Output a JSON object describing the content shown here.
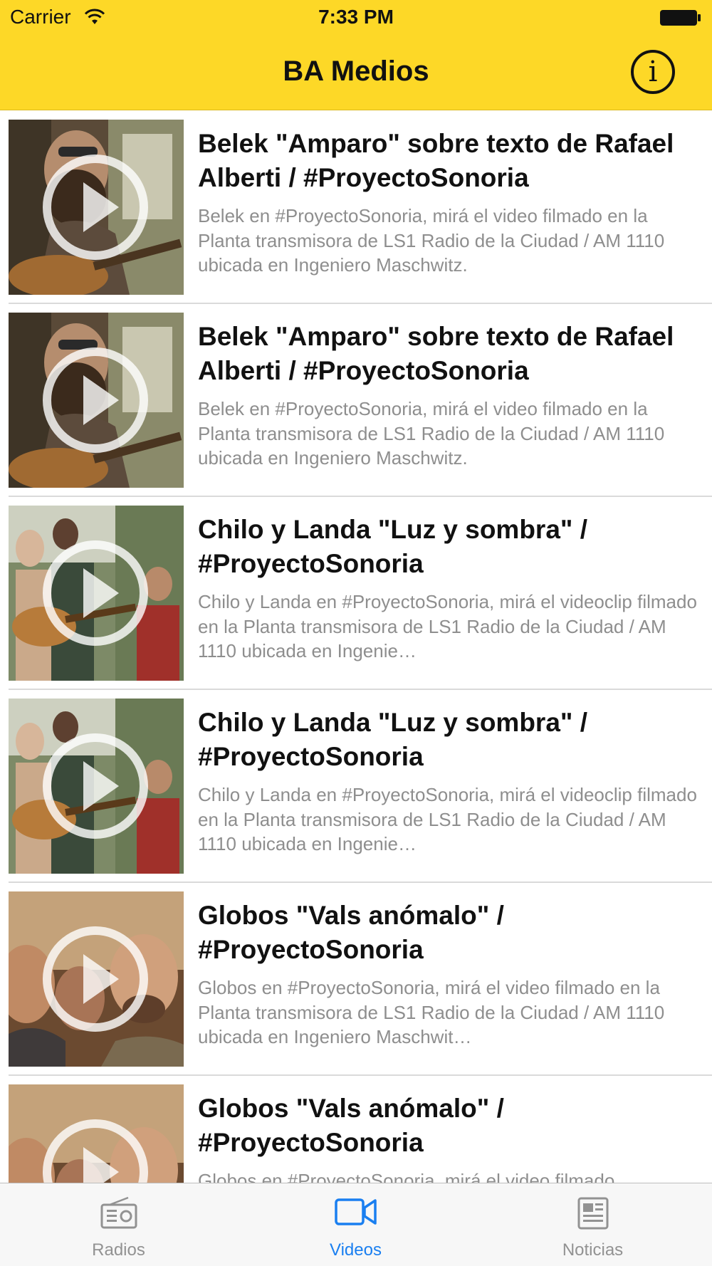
{
  "status_bar": {
    "carrier": "Carrier",
    "time": "7:33 PM"
  },
  "nav": {
    "title": "BA Medios",
    "info_icon": "info-icon"
  },
  "videos": [
    {
      "title": "Belek \"Amparo\" sobre texto de Rafael Alberti / #ProyectoSonoria",
      "description": "Belek en #ProyectoSonoria, mirá el video filmado en la Planta transmisora de LS1 Radio de la Ciudad / AM 1110 ubicada en Ingeniero Maschwitz.",
      "thumbnail": "belek"
    },
    {
      "title": "Belek \"Amparo\" sobre texto de Rafael Alberti / #ProyectoSonoria",
      "description": "Belek en #ProyectoSonoria, mirá el video filmado en la Planta transmisora de LS1 Radio de la Ciudad / AM 1110 ubicada en Ingeniero Maschwitz.",
      "thumbnail": "belek"
    },
    {
      "title": "Chilo y Landa \"Luz y sombra\" / #ProyectoSonoria",
      "description": "Chilo y Landa en #ProyectoSonoria, mirá el videoclip filmado en la Planta transmisora de LS1 Radio de la Ciudad / AM 1110 ubicada en Ingenie…",
      "thumbnail": "chilo"
    },
    {
      "title": "Chilo y Landa \"Luz y sombra\" / #ProyectoSonoria",
      "description": "Chilo y Landa en #ProyectoSonoria, mirá el videoclip filmado en la Planta transmisora de LS1 Radio de la Ciudad / AM 1110 ubicada en Ingenie…",
      "thumbnail": "chilo"
    },
    {
      "title": "Globos \"Vals anómalo\" / #ProyectoSonoria",
      "description": "Globos en #ProyectoSonoria, mirá el video filmado en la Planta transmisora de LS1 Radio de la Ciudad / AM 1110 ubicada en Ingeniero Maschwit…",
      "thumbnail": "globos"
    },
    {
      "title": "Globos \"Vals anómalo\" / #ProyectoSonoria",
      "description": "Globos en #ProyectoSonoria, mirá el video filmado",
      "thumbnail": "globos"
    }
  ],
  "tabs": [
    {
      "label": "Radios",
      "icon": "radio-icon",
      "active": false
    },
    {
      "label": "Videos",
      "icon": "video-camera-icon",
      "active": true
    },
    {
      "label": "Noticias",
      "icon": "newspaper-icon",
      "active": false
    }
  ],
  "colors": {
    "header": "#fdd827",
    "tab_active": "#1a7ff0",
    "tab_inactive": "#929292",
    "description": "#8e8e8e"
  }
}
